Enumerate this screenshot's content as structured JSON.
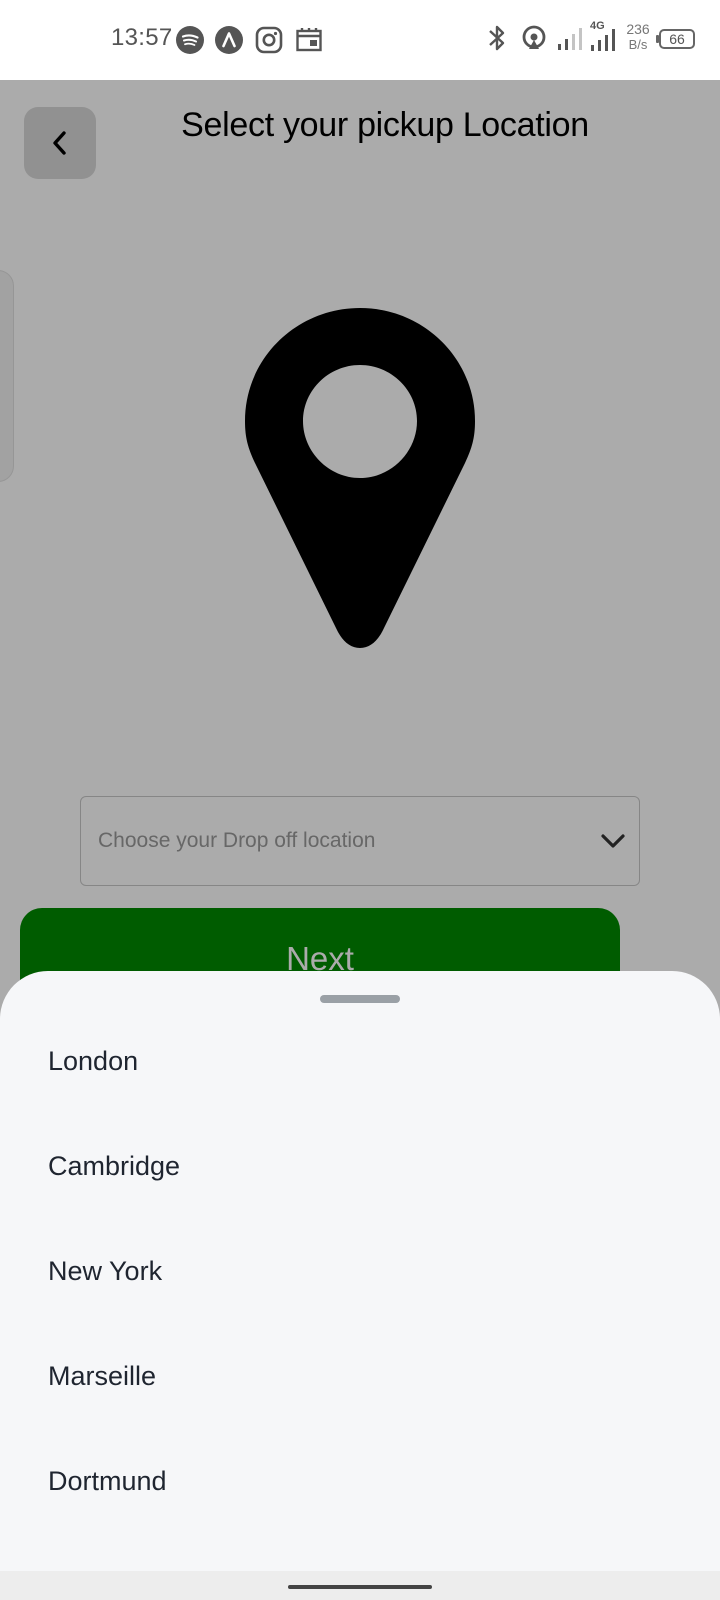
{
  "status_bar": {
    "time": "13:57",
    "left_icons": [
      "spotify-icon",
      "arc-app-icon",
      "instagram-icon",
      "calendar-app-icon"
    ],
    "network_type": "4G",
    "speed_value": "236",
    "speed_unit": "B/s",
    "battery": "66"
  },
  "header": {
    "title": "Select your pickup Location",
    "back_icon": "chevron-left-icon"
  },
  "main": {
    "illustration": "location-pin-icon",
    "dropdown": {
      "placeholder": "Choose your Drop off location",
      "icon": "chevron-down-icon"
    },
    "next_label": "Next"
  },
  "sheet": {
    "locations": [
      {
        "label": "London"
      },
      {
        "label": "Cambridge"
      },
      {
        "label": "New York"
      },
      {
        "label": "Marseille"
      },
      {
        "label": "Dortmund"
      }
    ]
  },
  "colors": {
    "accent_green": "#008a00",
    "sheet_background": "#f6f7f9",
    "scrim": "rgba(0,0,0,0.33)"
  }
}
